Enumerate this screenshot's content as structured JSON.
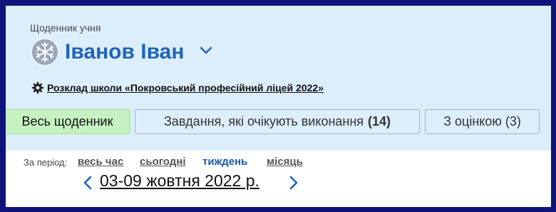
{
  "header": {
    "diary_label": "Щоденник учня",
    "student_name": "Іванов Іван",
    "schedule_link": "Розклад школи «Покровський професійний ліцей 2022»"
  },
  "tabs": [
    {
      "label": "Весь щоденник",
      "count": "",
      "active": true
    },
    {
      "label": "Завдання, які очікують виконання",
      "count": "(14)",
      "active": false
    },
    {
      "label": "З оцінкою (3)",
      "count": "",
      "active": false
    }
  ],
  "period": {
    "label": "За період:",
    "options": [
      "весь час",
      "сьогодні",
      "тиждень",
      "місяць"
    ],
    "selected": "тиждень"
  },
  "week": {
    "range": "03-09 жовтня 2022 р."
  },
  "icons": {
    "avatar": "snowflake-avatar-icon",
    "dropdown": "chevron-down-icon",
    "settings": "gear-icon",
    "prev": "chevron-left-icon",
    "next": "chevron-right-icon"
  },
  "colors": {
    "frame": "#0f137a",
    "background": "#ddeefb",
    "accent": "#1f64b8",
    "active_tab": "#c6f1c1"
  }
}
